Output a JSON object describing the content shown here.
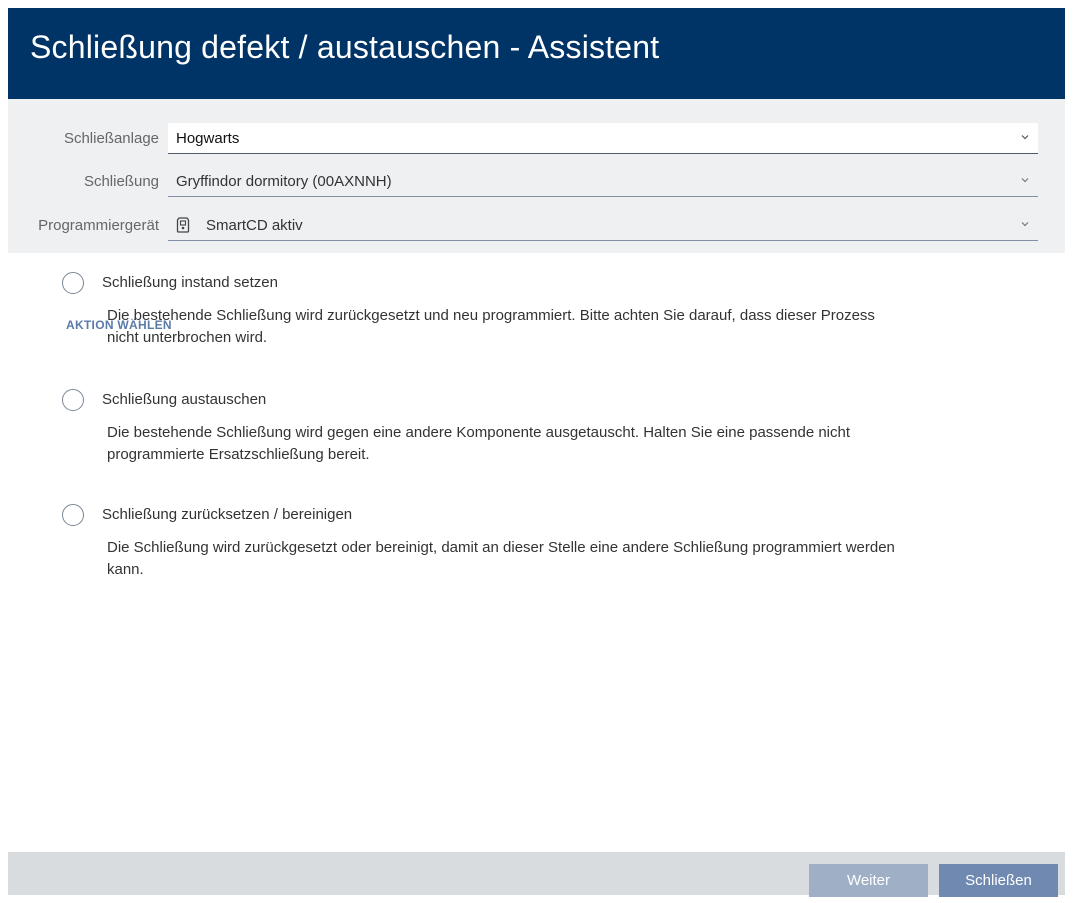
{
  "window": {
    "title": "Schließung defekt / austauschen - Assistent"
  },
  "form": {
    "locking_system": {
      "label": "Schließanlage",
      "value": "Hogwarts"
    },
    "lock": {
      "label": "Schließung",
      "value": "Gryffindor dormitory (00AXNNH)"
    },
    "programmer": {
      "label": "Programmiergerät",
      "value": "SmartCD aktiv",
      "icon": "smartcd-device-icon"
    }
  },
  "actions": {
    "section_title": "AKTION WÄHLEN",
    "options": [
      {
        "label": "Schließung instand setzen",
        "description": "Die bestehende Schließung wird zurückgesetzt und neu programmiert. Bitte achten Sie darauf, dass dieser Prozess nicht unterbrochen wird.",
        "selected": false
      },
      {
        "label": "Schließung austauschen",
        "description": "Die bestehende Schließung wird gegen eine andere Komponente ausgetauscht. Halten Sie eine passende nicht programmierte Ersatzschließung bereit.",
        "selected": false
      },
      {
        "label": "Schließung zurücksetzen / bereinigen",
        "description": "Die Schließung wird zurückgesetzt oder bereinigt, damit an dieser Stelle eine andere Schließung programmiert werden kann.",
        "selected": false
      }
    ]
  },
  "footer": {
    "next_label": "Weiter",
    "close_label": "Schließen"
  },
  "colors": {
    "title_bar": "#003366",
    "form_background": "#eef0f2",
    "section_title": "#5a7aa8",
    "button_next_disabled": "#9fb0c6",
    "button_close": "#6f89b0",
    "footer_background": "#d9dcdf"
  }
}
